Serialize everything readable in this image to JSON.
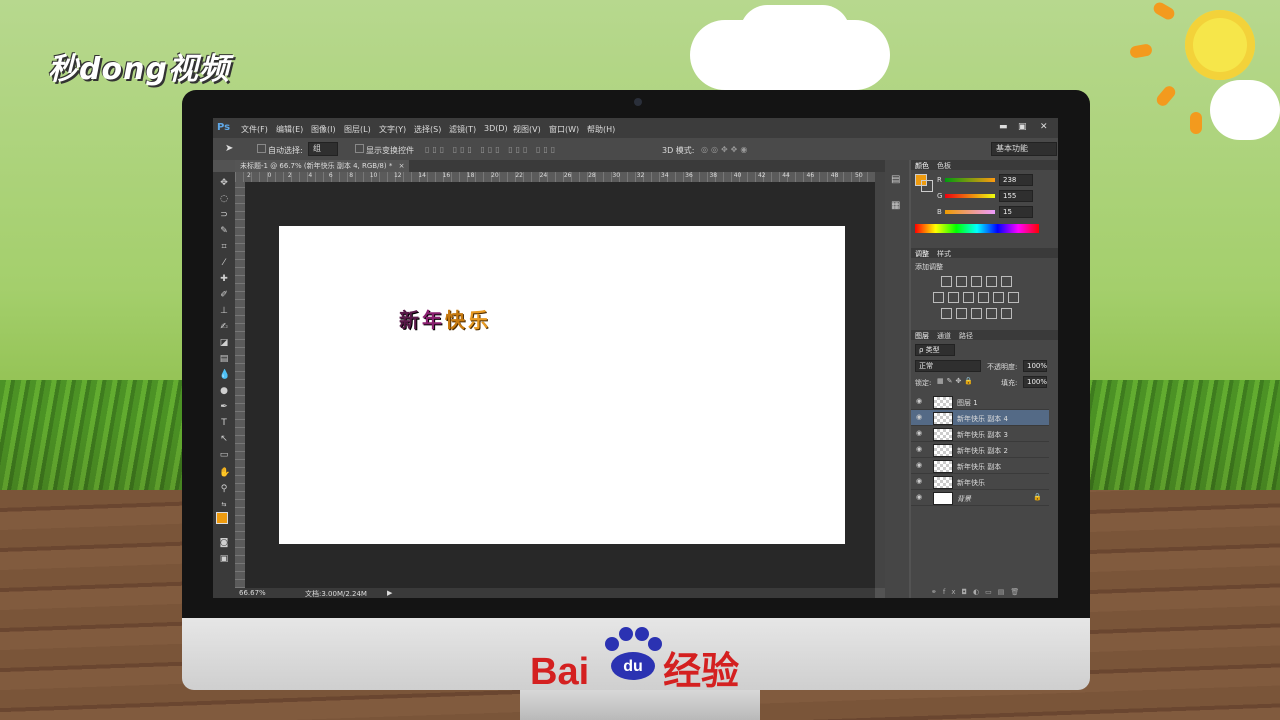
{
  "watermark": {
    "brand": "秒dong视频",
    "footer_brand": "Bai",
    "footer_du": "du",
    "footer_suffix": "经验"
  },
  "app": {
    "logo": "Ps"
  },
  "menu": [
    "文件(F)",
    "编辑(E)",
    "图像(I)",
    "图层(L)",
    "文字(Y)",
    "选择(S)",
    "滤镜(T)",
    "3D(D)",
    "视图(V)",
    "窗口(W)",
    "帮助(H)"
  ],
  "window_controls": {
    "minimize": "▬",
    "restore": "▣",
    "close": "✕"
  },
  "options": {
    "auto_select_label": "自动选择:",
    "auto_select_value": "组",
    "show_transform_label": "显示变换控件",
    "mode_3d_label": "3D 模式:",
    "workspace": "基本功能"
  },
  "document_tab": {
    "title": "未标题-1 @ 66.7% (新年快乐 副本 4, RGB/8) *",
    "close": "×"
  },
  "ruler_labels": [
    "2",
    "0",
    "2",
    "4",
    "6",
    "8",
    "10",
    "12",
    "14",
    "16",
    "18",
    "20",
    "22",
    "24",
    "26",
    "28",
    "30",
    "32",
    "34",
    "36",
    "38",
    "40",
    "42",
    "44",
    "46",
    "48",
    "50"
  ],
  "canvas_text": {
    "c1": "新",
    "c2": "年",
    "c3": "快",
    "c4": "乐"
  },
  "status": {
    "zoom": "66.67%",
    "doc": "文档:3.00M/2.24M"
  },
  "color_panel": {
    "tabs": [
      "颜色",
      "色板"
    ],
    "r_label": "R",
    "g_label": "G",
    "b_label": "B",
    "r": "238",
    "g": "155",
    "b": "15",
    "foreground": "#ee9b0f"
  },
  "adjust_panel": {
    "tabs": [
      "调整",
      "样式"
    ],
    "add_label": "添加调整"
  },
  "layers_panel": {
    "tabs": [
      "图层",
      "通道",
      "路径"
    ],
    "filter": "ρ 类型",
    "blend": "正常",
    "opacity_label": "不透明度:",
    "opacity": "100%",
    "lock_label": "锁定:",
    "fill_label": "填充:",
    "fill": "100%",
    "layers": [
      {
        "name": "图层 1"
      },
      {
        "name": "新年快乐 副本 4"
      },
      {
        "name": "新年快乐 副本 3"
      },
      {
        "name": "新年快乐 副本 2"
      },
      {
        "name": "新年快乐 副本"
      },
      {
        "name": "新年快乐"
      },
      {
        "name": "背景"
      }
    ],
    "selected_index": 1
  }
}
